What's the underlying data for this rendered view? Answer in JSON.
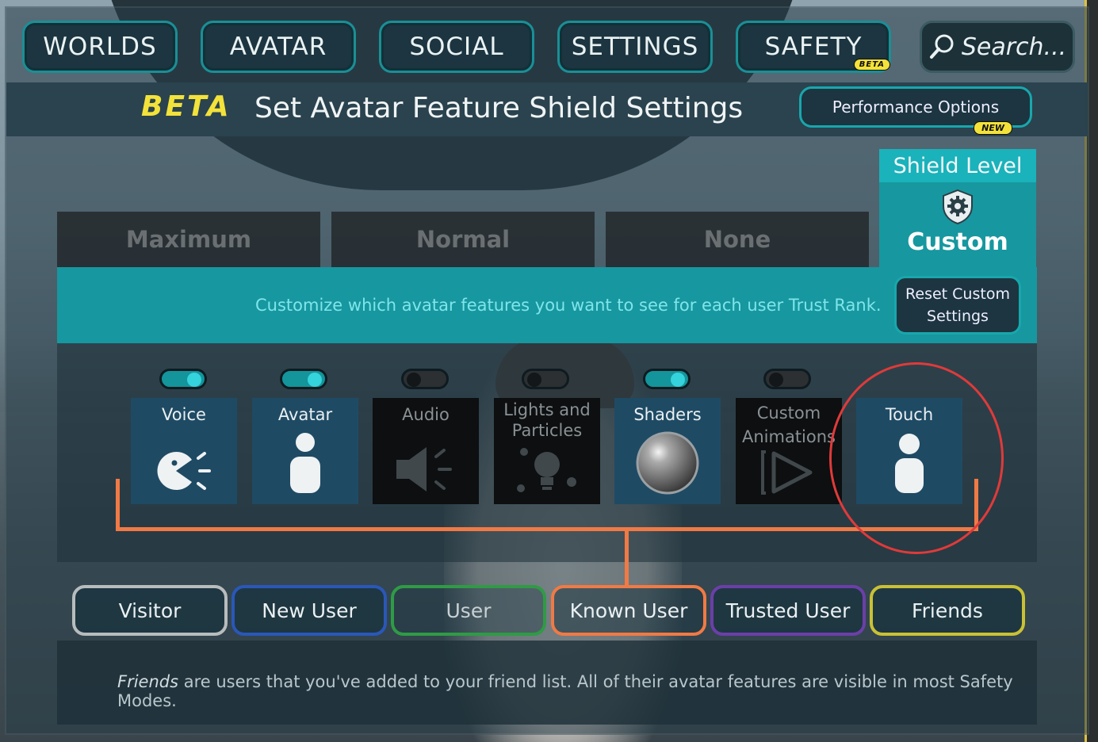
{
  "nav": {
    "items": [
      {
        "label": "WORLDS"
      },
      {
        "label": "AVATAR"
      },
      {
        "label": "SOCIAL"
      },
      {
        "label": "SETTINGS"
      },
      {
        "label": "SAFETY",
        "badge": "BETA"
      }
    ],
    "search_placeholder": "Search..."
  },
  "header": {
    "beta_label": "BETA",
    "title": "Set Avatar Feature Shield Settings",
    "performance_button": "Performance Options",
    "performance_badge": "NEW"
  },
  "levels": [
    "Maximum",
    "Normal",
    "None"
  ],
  "shield": {
    "header": "Shield Level",
    "value": "Custom",
    "icon": "shield-gear-icon"
  },
  "banner": {
    "message": "Customize which avatar features you want to see for each user Trust Rank.",
    "reset_button_line1": "Reset Custom",
    "reset_button_line2": "Settings"
  },
  "features": [
    {
      "label": "Voice",
      "enabled": true,
      "icon": "voice-icon"
    },
    {
      "label": "Avatar",
      "enabled": true,
      "icon": "avatar-person-icon"
    },
    {
      "label": "Audio",
      "enabled": false,
      "icon": "speaker-icon"
    },
    {
      "label_line1": "Lights and",
      "label_line2": "Particles",
      "enabled": false,
      "icon": "lightbulb-icon"
    },
    {
      "label": "Shaders",
      "enabled": true,
      "icon": "sphere-icon"
    },
    {
      "label_line1": "Custom",
      "label_line2": "Animations",
      "enabled": false,
      "icon": "play-icon"
    },
    {
      "label": "Touch",
      "enabled": true,
      "icon": "touch-person-icon"
    }
  ],
  "ranks": [
    {
      "label": "Visitor",
      "color": "#b8bcbd"
    },
    {
      "label": "New User",
      "color": "#2a57b8"
    },
    {
      "label": "User",
      "color": "#2f9b45"
    },
    {
      "label": "Known User",
      "color": "#f07a45"
    },
    {
      "label": "Trusted User",
      "color": "#6b3fa8"
    },
    {
      "label": "Friends",
      "color": "#c9c135"
    }
  ],
  "footer": {
    "emphasis": "Friends",
    "text": " are users that you've added to your friend list. All of their avatar features are visible in most Safety Modes."
  },
  "colors": {
    "accent_teal": "#17979f",
    "beta_yellow": "#f3e23a",
    "highlight_circle": "#e03a3a",
    "bracket_orange": "#f07a45"
  }
}
